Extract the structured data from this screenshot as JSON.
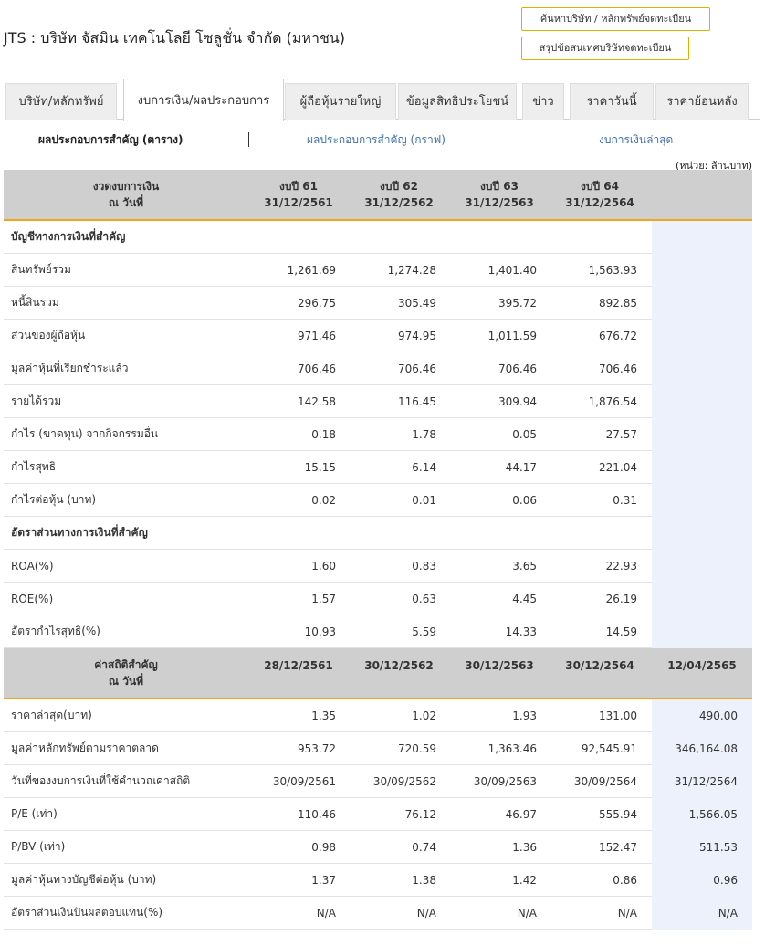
{
  "header": {
    "company_title": "JTS : บริษัท จัสมิน เทคโนโลยี โซลูชั่น จำกัด (มหาชน)",
    "btn_search": "ค้นหาบริษัท / หลักทรัพย์จดทะเบียน",
    "btn_summary": "สรุปข้อสนเทศบริษัทจดทะเบียน"
  },
  "tabs": [
    {
      "label": "บริษัท/หลักทรัพย์"
    },
    {
      "label": "งบการเงิน/ผลประกอบการ"
    },
    {
      "label": "ผู้ถือหุ้นรายใหญ่"
    },
    {
      "label": "ข้อมูลสิทธิประโยชน์"
    },
    {
      "label": "ข่าว"
    },
    {
      "label": "ราคาวันนี้"
    },
    {
      "label": "ราคาย้อนหลัง"
    }
  ],
  "subnav": {
    "table": "ผลประกอบการสำคัญ (ตาราง)",
    "graph": "ผลประกอบการสำคัญ (กราฟ)",
    "latest": "งบการเงินล่าสุด"
  },
  "unit": "(หน่วย: ล้านบาท)",
  "fin_header": {
    "label_l1": "งวดงบการเงิน",
    "label_l2": "ณ วันที่",
    "cols": [
      {
        "year": "งบปี 61",
        "date": "31/12/2561"
      },
      {
        "year": "งบปี 62",
        "date": "31/12/2562"
      },
      {
        "year": "งบปี 63",
        "date": "31/12/2563"
      },
      {
        "year": "งบปี 64",
        "date": "31/12/2564"
      }
    ]
  },
  "sec_accounts": "บัญชีทางการเงินที่สำคัญ",
  "accounts": [
    {
      "label": "สินทรัพย์รวม",
      "v": [
        "1,261.69",
        "1,274.28",
        "1,401.40",
        "1,563.93"
      ]
    },
    {
      "label": "หนี้สินรวม",
      "v": [
        "296.75",
        "305.49",
        "395.72",
        "892.85"
      ]
    },
    {
      "label": "ส่วนของผู้ถือหุ้น",
      "v": [
        "971.46",
        "974.95",
        "1,011.59",
        "676.72"
      ]
    },
    {
      "label": "มูลค่าหุ้นที่เรียกชำระแล้ว",
      "v": [
        "706.46",
        "706.46",
        "706.46",
        "706.46"
      ]
    },
    {
      "label": "รายได้รวม",
      "v": [
        "142.58",
        "116.45",
        "309.94",
        "1,876.54"
      ]
    },
    {
      "label": "กำไร (ขาดทุน) จากกิจกรรมอื่น",
      "v": [
        "0.18",
        "1.78",
        "0.05",
        "27.57"
      ]
    },
    {
      "label": "กำไรสุทธิ",
      "v": [
        "15.15",
        "6.14",
        "44.17",
        "221.04"
      ]
    },
    {
      "label": "กำไรต่อหุ้น (บาท)",
      "v": [
        "0.02",
        "0.01",
        "0.06",
        "0.31"
      ]
    }
  ],
  "sec_ratios": "อัตราส่วนทางการเงินที่สำคัญ",
  "ratios": [
    {
      "label": "ROA(%)",
      "v": [
        "1.60",
        "0.83",
        "3.65",
        "22.93"
      ]
    },
    {
      "label": "ROE(%)",
      "v": [
        "1.57",
        "0.63",
        "4.45",
        "26.19"
      ]
    },
    {
      "label": "อัตรากำไรสุทธิ(%)",
      "v": [
        "10.93",
        "5.59",
        "14.33",
        "14.59"
      ]
    }
  ],
  "stat_header": {
    "label_l1": "ค่าสถิติสำคัญ",
    "label_l2": "ณ วันที่",
    "dates": [
      "28/12/2561",
      "30/12/2562",
      "30/12/2563",
      "30/12/2564",
      "12/04/2565"
    ]
  },
  "stats": [
    {
      "label": "ราคาล่าสุด(บาท)",
      "v": [
        "1.35",
        "1.02",
        "1.93",
        "131.00",
        "490.00"
      ]
    },
    {
      "label": "มูลค่าหลักทรัพย์ตามราคาตลาด",
      "v": [
        "953.72",
        "720.59",
        "1,363.46",
        "92,545.91",
        "346,164.08"
      ]
    },
    {
      "label": "วันที่ของงบการเงินที่ใช้คำนวณค่าสถิติ",
      "v": [
        "30/09/2561",
        "30/09/2562",
        "30/09/2563",
        "30/09/2564",
        "31/12/2564"
      ]
    },
    {
      "label": "P/E (เท่า)",
      "v": [
        "110.46",
        "76.12",
        "46.97",
        "555.94",
        "1,566.05"
      ]
    },
    {
      "label": "P/BV (เท่า)",
      "v": [
        "0.98",
        "0.74",
        "1.36",
        "152.47",
        "511.53"
      ]
    },
    {
      "label": "มูลค่าหุ้นทางบัญชีต่อหุ้น (บาท)",
      "v": [
        "1.37",
        "1.38",
        "1.42",
        "0.86",
        "0.96"
      ]
    },
    {
      "label": "อัตราส่วนเงินปันผลตอบแทน(%)",
      "v": [
        "N/A",
        "N/A",
        "N/A",
        "N/A",
        "N/A"
      ]
    }
  ]
}
